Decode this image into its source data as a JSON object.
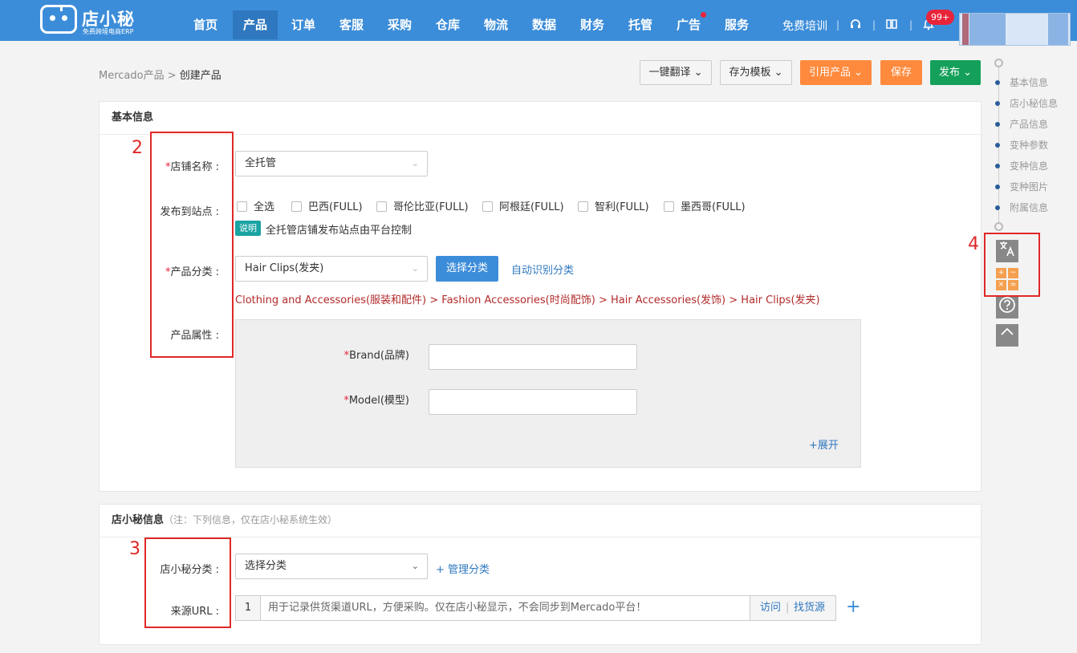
{
  "app": {
    "logo_text": "店小秘",
    "logo_sub": "免费跨境电商ERP"
  },
  "nav": [
    {
      "label": "首页"
    },
    {
      "label": "产品",
      "active": true
    },
    {
      "label": "订单"
    },
    {
      "label": "客服"
    },
    {
      "label": "采购"
    },
    {
      "label": "仓库"
    },
    {
      "label": "物流"
    },
    {
      "label": "数据"
    },
    {
      "label": "财务"
    },
    {
      "label": "托管"
    },
    {
      "label": "广告",
      "dot": true
    },
    {
      "label": "服务"
    }
  ],
  "topbar": {
    "training": "免费培训",
    "separator": "|",
    "notify_count": "99+",
    "headset_icon": "headset-icon",
    "book_icon": "book-icon",
    "bell_icon": "bell-icon"
  },
  "breadcrumb": {
    "parent": "Mercado产品",
    "sep": ">",
    "current": "创建产品"
  },
  "actions": {
    "translate": "一键翻译 ⌄",
    "save_template": "存为模板 ⌄",
    "cite": "引用产品 ⌄",
    "save": "保存",
    "publish": "发布 ⌄"
  },
  "basic": {
    "title": "基本信息",
    "shop_label": "店铺名称 :",
    "shop_value": "全托管",
    "sites_label": "发布到站点 :",
    "sites": [
      "全选",
      "巴西(FULL)",
      "哥伦比亚(FULL)",
      "阿根廷(FULL)",
      "智利(FULL)",
      "墨西哥(FULL)"
    ],
    "note_tag": "说明",
    "note_text": "全托管店铺发布站点由平台控制",
    "category_label": "产品分类 :",
    "category_value": "Hair Clips(发夹)",
    "choose_category": "选择分类",
    "auto_category": "自动识别分类",
    "category_path": "Clothing and Accessories(服装和配件) > Fashion Accessories(时尚配饰) > Hair Accessories(发饰) > Hair Clips(发夹)",
    "attr_label": "产品属性 :",
    "brand_label": "Brand(品牌)",
    "model_label": "Model(模型)",
    "expand": "+展开",
    "required_mark": "*"
  },
  "dxm": {
    "title": "店小秘信息",
    "title_note": "（注：下列信息，仅在店小秘系统生效）",
    "cat_label": "店小秘分类 :",
    "cat_value": "选择分类",
    "manage": "+ 管理分类",
    "url_label": "来源URL :",
    "url_index": "1",
    "url_placeholder": "用于记录供货渠道URL，方便采购。仅在店小秘显示，不会同步到Mercado平台！",
    "visit": "访问",
    "source": "找货源",
    "add": "+"
  },
  "toc": [
    "基本信息",
    "店小秘信息",
    "产品信息",
    "变种参数",
    "变种信息",
    "变种图片",
    "附属信息"
  ],
  "annotations": {
    "n2": "2",
    "n3": "3",
    "n4": "4"
  },
  "tools": {
    "translate_icon": "translate-icon",
    "calculator_icon": "calculator-icon",
    "help_icon": "help-icon",
    "top_icon": "chevron-up-icon"
  },
  "colors": {
    "topbar": "#3c8dd9",
    "orange": "#ff8a3d",
    "green": "#14a05a",
    "annotation": "#e02828"
  }
}
